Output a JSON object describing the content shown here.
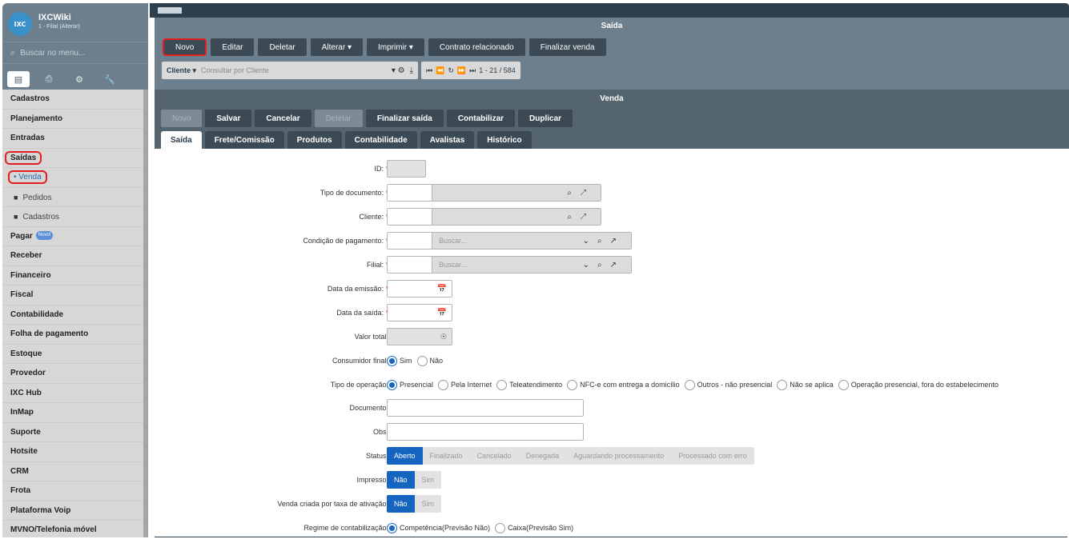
{
  "app": {
    "name": "IXCWiki",
    "subtitle": "1 - Filial (Alterar)",
    "logo_text": "IXC",
    "search_placeholder": "Buscar no menu...",
    "search_icon": "search-icon"
  },
  "sidebar": {
    "tabs": [
      "list-icon",
      "print-icon",
      "gears-icon",
      "wrench-icon"
    ],
    "items": [
      {
        "label": "Cadastros"
      },
      {
        "label": "Planejamento"
      },
      {
        "label": "Entradas"
      },
      {
        "label": "Saídas"
      },
      {
        "label": "Venda"
      },
      {
        "label": "Pedidos"
      },
      {
        "label": "Cadastros"
      },
      {
        "label": "Pagar",
        "badge": "Novo!"
      },
      {
        "label": "Receber"
      },
      {
        "label": "Financeiro"
      },
      {
        "label": "Fiscal"
      },
      {
        "label": "Contabilidade"
      },
      {
        "label": "Folha de pagamento"
      },
      {
        "label": "Estoque"
      },
      {
        "label": "Provedor"
      },
      {
        "label": "IXC Hub"
      },
      {
        "label": "InMap"
      },
      {
        "label": "Suporte"
      },
      {
        "label": "Hotsite"
      },
      {
        "label": "CRM"
      },
      {
        "label": "Frota"
      },
      {
        "label": "Plataforma Voip"
      },
      {
        "label": "MVNO/Telefonia móvel"
      }
    ]
  },
  "window": {
    "title": "Saída"
  },
  "toolbar": {
    "novo": "Novo",
    "editar": "Editar",
    "deletar": "Deletar",
    "alterar": "Alterar ▾",
    "imprimir": "Imprimir ▾",
    "contrato": "Contrato relacionado",
    "finalizar": "Finalizar venda"
  },
  "search": {
    "field": "Cliente ▾",
    "placeholder": "Consultar por Cliente",
    "pager": "1 - 21 / 584"
  },
  "form": {
    "title": "Venda",
    "actions": {
      "novo": "Novo",
      "salvar": "Salvar",
      "cancelar": "Cancelar",
      "deletar": "Deletar",
      "finalizar": "Finalizar saída",
      "contabilizar": "Contabilizar",
      "duplicar": "Duplicar"
    },
    "tabs": [
      "Saída",
      "Frete/Comissão",
      "Produtos",
      "Contabilidade",
      "Avalistas",
      "Histórico"
    ],
    "labels": {
      "id": "ID:",
      "tipo_doc": "Tipo de documento:",
      "cliente": "Cliente:",
      "condicao": "Condição de pagamento:",
      "filial": "Filial:",
      "data_emissao": "Data da emissão:",
      "data_saida": "Data da saída:",
      "valor_total": "Valor total:",
      "consumidor": "Consumidor final:",
      "tipo_operacao": "Tipo de operação:",
      "documento": "Documento:",
      "obs": "Obs:",
      "status": "Status:",
      "impresso": "Impresso:",
      "venda_taxa": "Venda criada por taxa de ativação:",
      "regime": "Regime de contabilização:"
    },
    "required_mark": "*",
    "buscar_placeholder": "Buscar...",
    "consumidor": [
      "Sim",
      "Não"
    ],
    "tipo_operacao": [
      "Presencial",
      "Pela Internet",
      "Teleatendimento",
      "NFC-e com entrega a domicílio",
      "Outros - não presencial",
      "Não se aplica",
      "Operação presencial, fora do estabelecimento"
    ],
    "status": [
      "Aberto",
      "Finalizado",
      "Cancelado",
      "Denegada",
      "Aguardando processamento",
      "Processado com erro"
    ],
    "impresso": [
      "Não",
      "Sim"
    ],
    "venda_taxa": [
      "Não",
      "Sim"
    ],
    "regime": [
      "Competência(Previsão Não)",
      "Caixa(Previsão Sim)"
    ]
  }
}
